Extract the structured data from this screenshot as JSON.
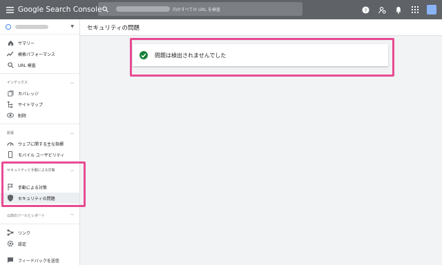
{
  "app": {
    "product_name": "Google Search Console",
    "search_placeholder": "内のすべての URL を検査"
  },
  "sidebar": {
    "items": [
      {
        "label": "サマリー",
        "icon": "home-icon"
      },
      {
        "label": "検索パフォーマンス",
        "icon": "trending-up-icon"
      },
      {
        "label": "URL 検査",
        "icon": "search-icon"
      }
    ],
    "sections": [
      {
        "title": "インデックス",
        "items": [
          {
            "label": "カバレッジ",
            "icon": "file-copy-icon"
          },
          {
            "label": "サイトマップ",
            "icon": "sitemap-icon"
          },
          {
            "label": "削除",
            "icon": "remove-eye-icon"
          }
        ]
      },
      {
        "title": "拡張",
        "items": [
          {
            "label": "ウェブに関する主な指標",
            "icon": "speed-icon"
          },
          {
            "label": "モバイル ユーザビリティ",
            "icon": "smartphone-icon"
          }
        ]
      },
      {
        "title": "セキュリティと手動による対策",
        "items": [
          {
            "label": "手動による対策",
            "icon": "flag-icon"
          },
          {
            "label": "セキュリティの問題",
            "icon": "shield-icon"
          }
        ]
      },
      {
        "title": "以前のツールとレポート",
        "items": []
      }
    ],
    "bottom_items": [
      {
        "label": "リンク",
        "icon": "links-icon"
      },
      {
        "label": "設定",
        "icon": "settings-icon"
      },
      {
        "label": "フィードバックを送信",
        "icon": "feedback-icon"
      }
    ]
  },
  "main": {
    "page_title": "セキュリティの問題",
    "status_message": "問題は検出されませんでした"
  },
  "colors": {
    "app_bar": "#5f6368",
    "highlight": "#e84a92",
    "success": "#188038"
  }
}
